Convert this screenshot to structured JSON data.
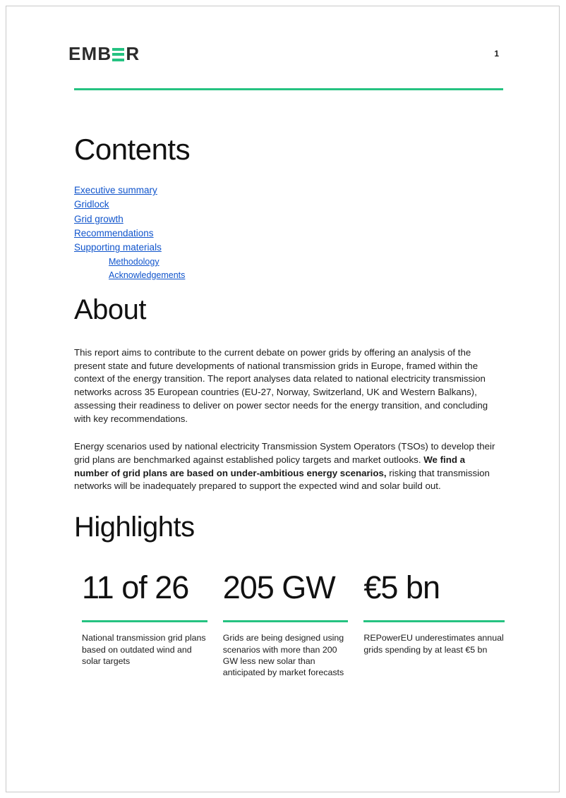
{
  "header": {
    "logo_text_before": "EMB",
    "logo_text_after": "R",
    "logo_name": "EMBER",
    "page_number": "1",
    "accent_color": "#25c281",
    "link_color": "#1155cc"
  },
  "contents": {
    "title": "Contents",
    "items": [
      {
        "label": "Executive summary",
        "level": 0
      },
      {
        "label": "Gridlock",
        "level": 0
      },
      {
        "label": "Grid growth",
        "level": 0
      },
      {
        "label": "Recommendations",
        "level": 0
      },
      {
        "label": "Supporting materials",
        "level": 0
      },
      {
        "label": "Methodology",
        "level": 1
      },
      {
        "label": "Acknowledgements",
        "level": 1
      }
    ]
  },
  "about": {
    "title": "About",
    "paragraph_1": "This report aims to contribute to the current debate on power grids by offering an analysis of the present state and future developments of national transmission grids in Europe, framed within the context of the energy transition. The report analyses data related to national electricity transmission networks across 35 European countries (EU-27, Norway, Switzerland, UK and Western Balkans), assessing their readiness to deliver on power sector needs for the energy transition, and concluding with key recommendations.",
    "paragraph_2_part_1": "Energy scenarios used by national electricity Transmission System Operators (TSOs) to develop their grid plans are benchmarked against established policy targets and market outlooks. ",
    "paragraph_2_bold": "We find a number of grid plans are based on under-ambitious energy scenarios,",
    "paragraph_2_part_2": " risking that transmission networks will be inadequately prepared to support the expected wind and solar build out."
  },
  "highlights": {
    "title": "Highlights",
    "stats": [
      {
        "value": "11 of 26",
        "caption": "National transmission grid plans based on outdated wind and solar targets"
      },
      {
        "value": "205 GW",
        "caption": "Grids are being designed using scenarios with more than 200 GW less new solar than anticipated by market forecasts"
      },
      {
        "value": "€5 bn",
        "caption": "REPowerEU underestimates annual grids spending by at least €5 bn"
      }
    ]
  }
}
